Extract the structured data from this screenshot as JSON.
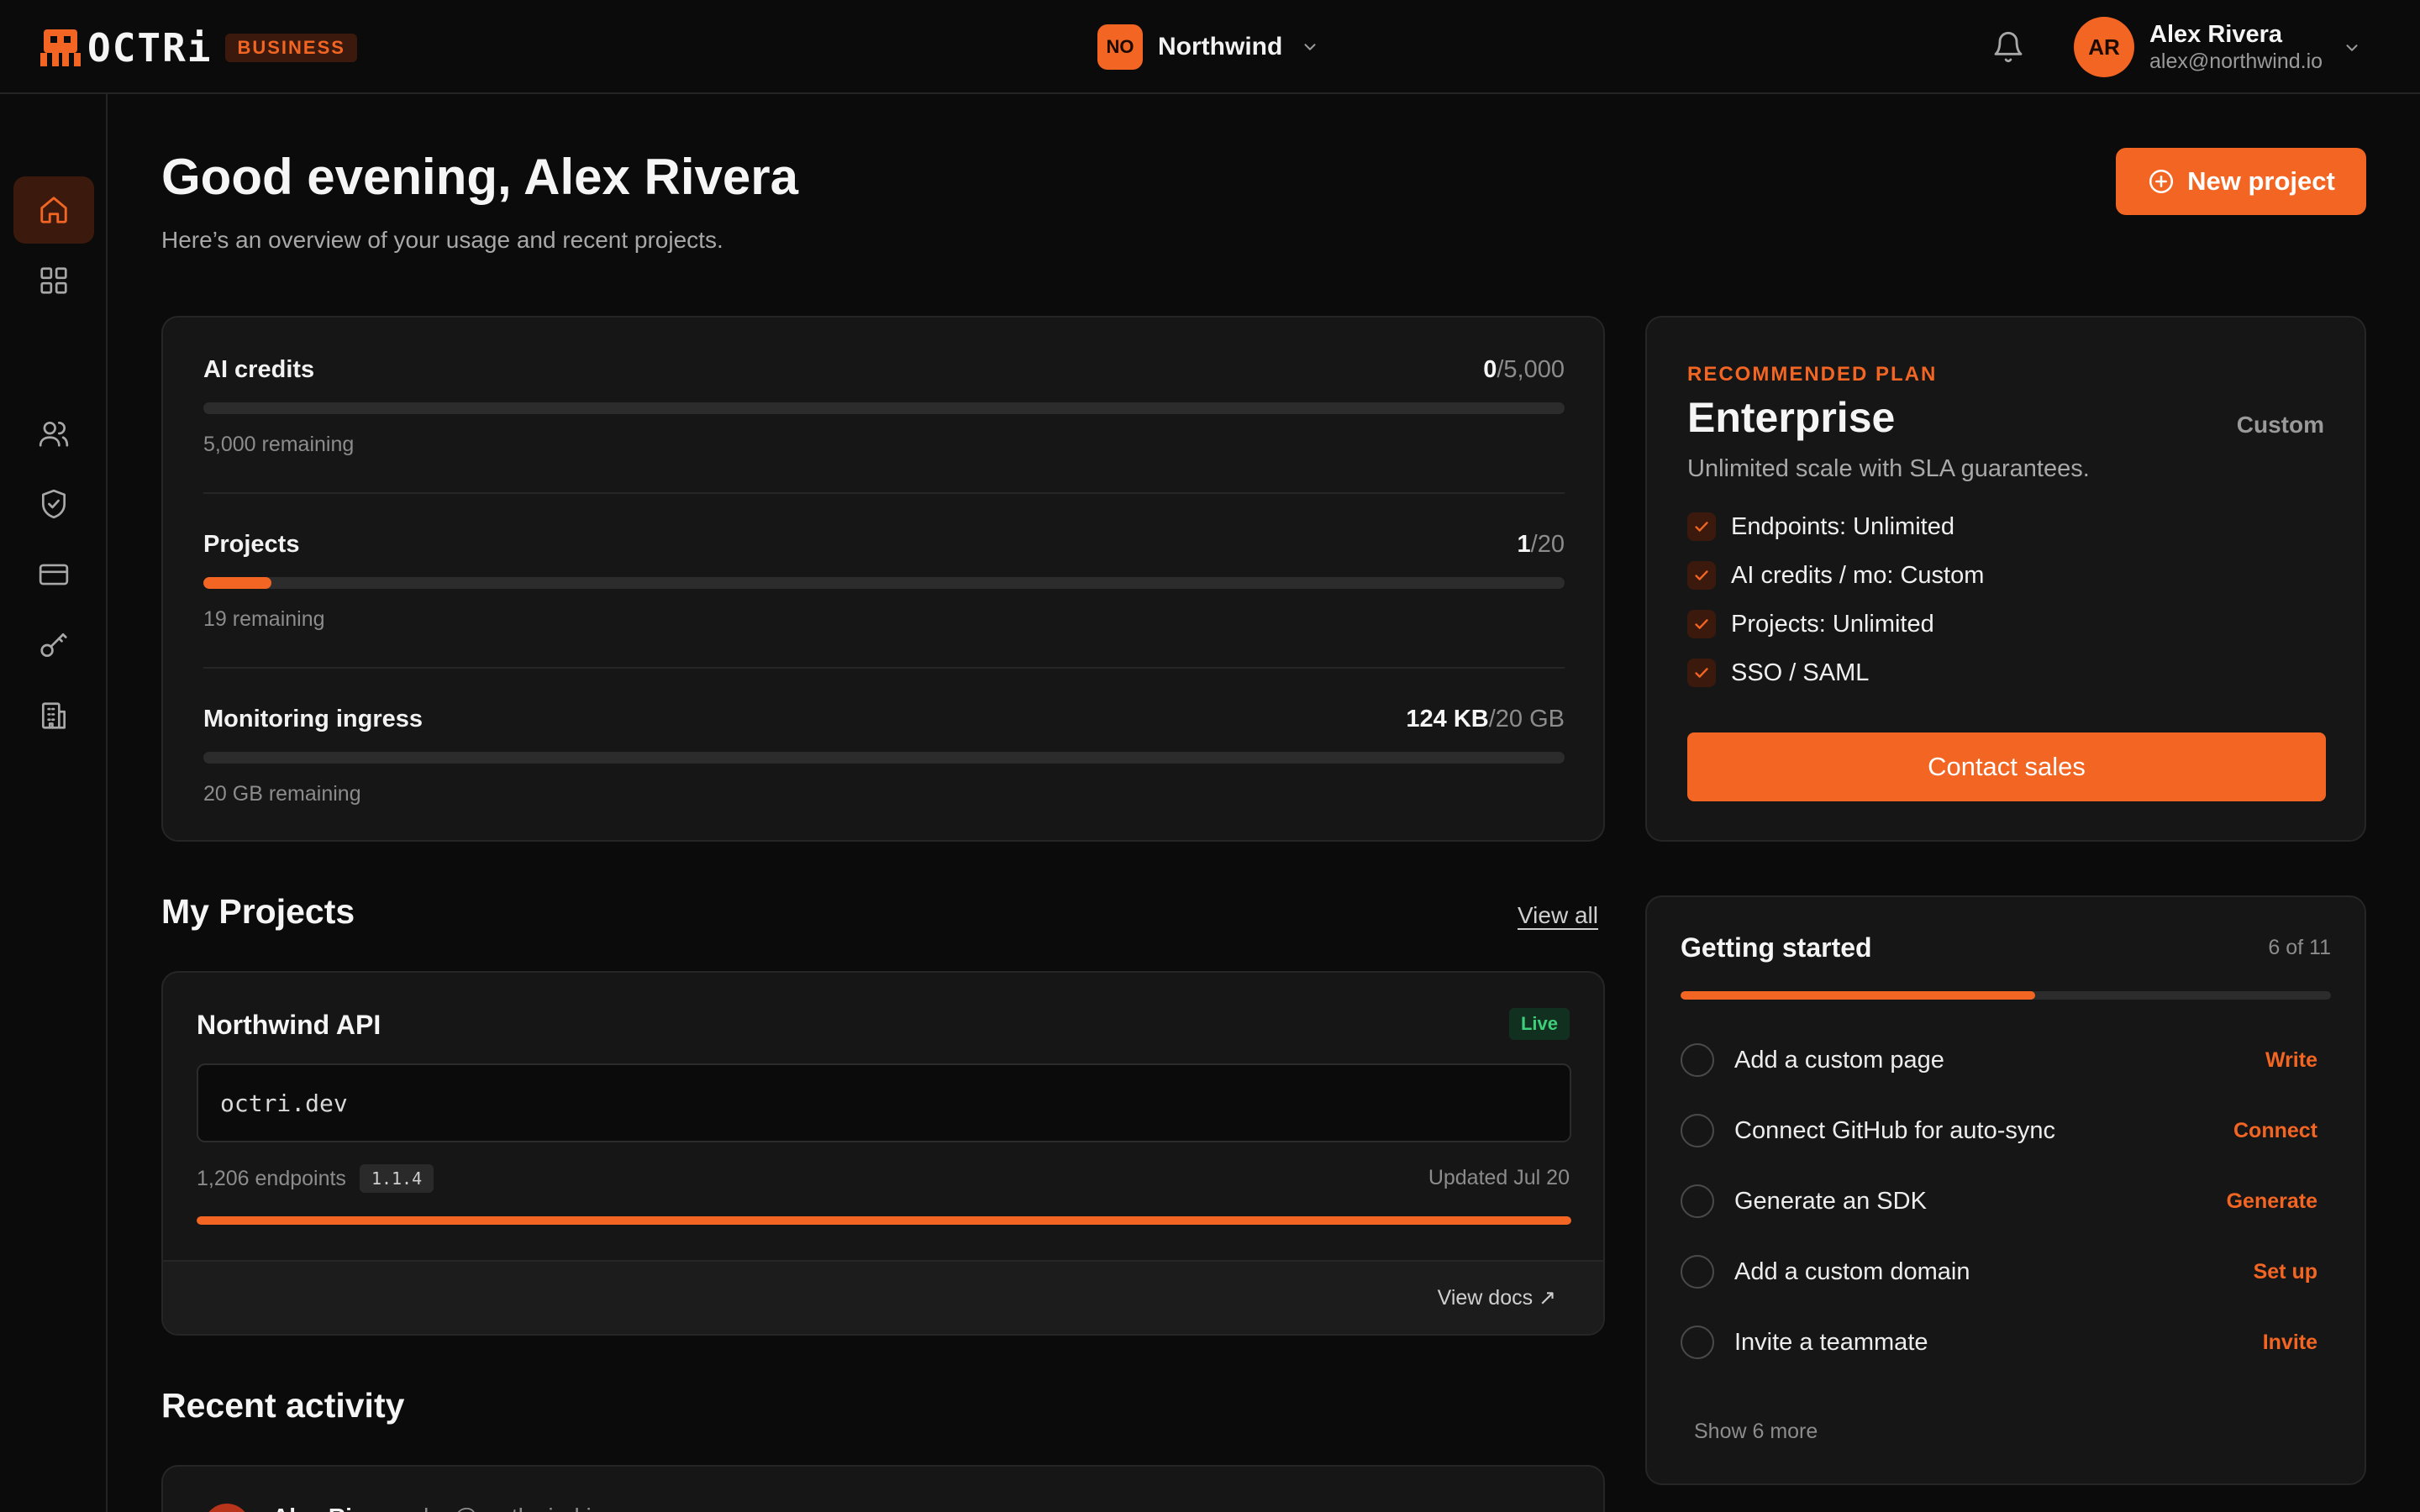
{
  "brand": {
    "name": "OCTRi",
    "badge": "BUSINESS",
    "accent": "#f26522"
  },
  "org": {
    "initials": "NO",
    "name": "Northwind"
  },
  "user": {
    "initials": "AR",
    "name": "Alex Rivera",
    "email": "alex@northwind.io"
  },
  "sidebar": {
    "items": [
      {
        "icon": "home-icon",
        "active": true
      },
      {
        "icon": "grid-icon",
        "active": false
      },
      {
        "icon": "users-icon",
        "active": false
      },
      {
        "icon": "shield-icon",
        "active": false
      },
      {
        "icon": "credit-card-icon",
        "active": false
      },
      {
        "icon": "key-icon",
        "active": false
      },
      {
        "icon": "building-icon",
        "active": false
      }
    ]
  },
  "page": {
    "greeting": "Good evening, Alex Rivera",
    "subtitle": "Here’s an overview of your usage and recent projects.",
    "new_project_label": "New project"
  },
  "usage": [
    {
      "label": "AI credits",
      "used": "0",
      "limit": "/5,000",
      "remaining": "5,000 remaining",
      "fraction": 0.0
    },
    {
      "label": "Projects",
      "used": "1",
      "limit": "/20",
      "remaining": "19 remaining",
      "fraction": 0.05
    },
    {
      "label": "Monitoring ingress",
      "used": "124 KB",
      "limit": "/20 GB",
      "remaining": "20 GB remaining",
      "fraction": 0.0
    }
  ],
  "plan": {
    "eyebrow": "RECOMMENDED PLAN",
    "name": "Enterprise",
    "price": "Custom",
    "description": "Unlimited scale with SLA guarantees.",
    "features": [
      "Endpoints: Unlimited",
      "AI credits / mo: Custom",
      "Projects: Unlimited",
      "SSO / SAML"
    ],
    "cta": "Contact sales"
  },
  "projects": {
    "title": "My Projects",
    "view_all": "View all",
    "items": [
      {
        "name": "Northwind API",
        "status": "Live",
        "domain": "octri.dev",
        "endpoints": "1,206 endpoints",
        "version": "1.1.4",
        "updated": "Updated Jul 20",
        "progress": 1.0,
        "docs_label": "View docs ↗"
      }
    ]
  },
  "activity": {
    "title": "Recent activity",
    "first": {
      "name": "Alex Rivera",
      "detail": "alex@northwind.io"
    }
  },
  "getting_started": {
    "title": "Getting started",
    "count": "6 of 11",
    "progress": 0.545,
    "items": [
      {
        "label": "Add a custom page",
        "action": "Write"
      },
      {
        "label": "Connect GitHub for auto-sync",
        "action": "Connect"
      },
      {
        "label": "Generate an SDK",
        "action": "Generate"
      },
      {
        "label": "Add a custom domain",
        "action": "Set up"
      },
      {
        "label": "Invite a teammate",
        "action": "Invite"
      }
    ],
    "show_more": "Show 6 more"
  }
}
